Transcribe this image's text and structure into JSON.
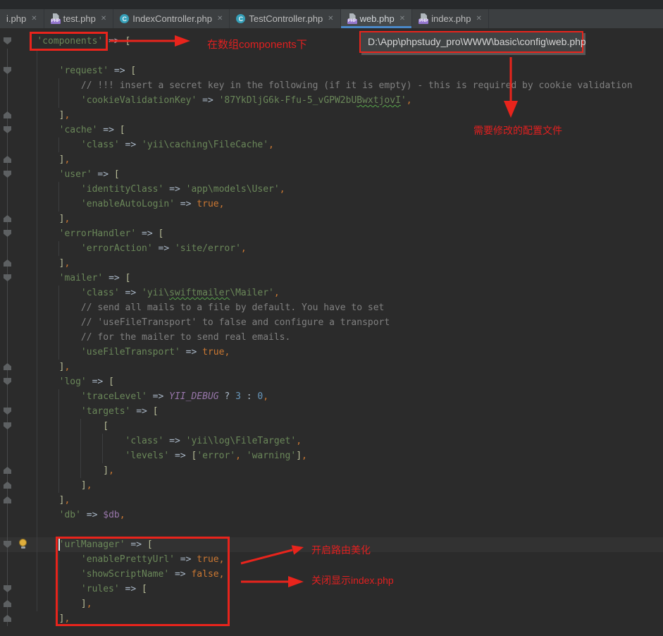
{
  "tabs": [
    {
      "label": "i.php",
      "icon": null,
      "active": false
    },
    {
      "label": "test.php",
      "icon": "php",
      "active": false
    },
    {
      "label": "IndexController.php",
      "icon": "class",
      "active": false
    },
    {
      "label": "TestController.php",
      "icon": "class",
      "active": false
    },
    {
      "label": "web.php",
      "icon": "php",
      "active": true
    },
    {
      "label": "index.php",
      "icon": "php",
      "active": false
    }
  ],
  "icons": {
    "close": "✕",
    "php_badge": "PHP",
    "class_badge": "C",
    "lightbulb": "intention-bulb"
  },
  "editor": {
    "current_line": 34,
    "bulb_line": 34,
    "caret_line": 34,
    "fold_starts": [
      0,
      2,
      6,
      9,
      13,
      16,
      23,
      25,
      26,
      34,
      37
    ],
    "fold_ends": [
      5,
      8,
      12,
      15,
      22,
      29,
      30,
      31,
      38,
      39
    ],
    "code_lines": [
      [
        [
          "t",
          "    "
        ],
        [
          "s",
          "'components'"
        ],
        [
          "o",
          " => "
        ],
        [
          "b",
          "["
        ]
      ],
      [],
      [
        [
          "t",
          "        "
        ],
        [
          "s",
          "'request'"
        ],
        [
          "o",
          " => "
        ],
        [
          "b",
          "["
        ]
      ],
      [
        [
          "t",
          "            "
        ],
        [
          "m",
          "// !!! insert a secret key in the following (if it is empty) - this is required by cookie validation"
        ]
      ],
      [
        [
          "t",
          "            "
        ],
        [
          "s",
          "'cookieValidationKey'"
        ],
        [
          "o",
          " => "
        ],
        [
          "s",
          "'87YkDljG6k-Ffu-5_vGPW2bU"
        ],
        [
          "w",
          "BwxtjovI"
        ],
        [
          "s",
          "'"
        ],
        [
          "c",
          ","
        ]
      ],
      [
        [
          "t",
          "        "
        ],
        [
          "b",
          "]"
        ],
        [
          "c",
          ","
        ]
      ],
      [
        [
          "t",
          "        "
        ],
        [
          "s",
          "'cache'"
        ],
        [
          "o",
          " => "
        ],
        [
          "b",
          "["
        ]
      ],
      [
        [
          "t",
          "            "
        ],
        [
          "s",
          "'class'"
        ],
        [
          "o",
          " => "
        ],
        [
          "s",
          "'yii\\caching\\FileCache'"
        ],
        [
          "c",
          ","
        ]
      ],
      [
        [
          "t",
          "        "
        ],
        [
          "b",
          "]"
        ],
        [
          "c",
          ","
        ]
      ],
      [
        [
          "t",
          "        "
        ],
        [
          "s",
          "'user'"
        ],
        [
          "o",
          " => "
        ],
        [
          "b",
          "["
        ]
      ],
      [
        [
          "t",
          "            "
        ],
        [
          "s",
          "'identityClass'"
        ],
        [
          "o",
          " => "
        ],
        [
          "s",
          "'app\\models\\User'"
        ],
        [
          "c",
          ","
        ]
      ],
      [
        [
          "t",
          "            "
        ],
        [
          "s",
          "'enableAutoLogin'"
        ],
        [
          "o",
          " => "
        ],
        [
          "k",
          "true"
        ],
        [
          "c",
          ","
        ]
      ],
      [
        [
          "t",
          "        "
        ],
        [
          "b",
          "]"
        ],
        [
          "c",
          ","
        ]
      ],
      [
        [
          "t",
          "        "
        ],
        [
          "s",
          "'errorHandler'"
        ],
        [
          "o",
          " => "
        ],
        [
          "b",
          "["
        ]
      ],
      [
        [
          "t",
          "            "
        ],
        [
          "s",
          "'errorAction'"
        ],
        [
          "o",
          " => "
        ],
        [
          "s",
          "'site/error'"
        ],
        [
          "c",
          ","
        ]
      ],
      [
        [
          "t",
          "        "
        ],
        [
          "b",
          "]"
        ],
        [
          "c",
          ","
        ]
      ],
      [
        [
          "t",
          "        "
        ],
        [
          "s",
          "'mailer'"
        ],
        [
          "o",
          " => "
        ],
        [
          "b",
          "["
        ]
      ],
      [
        [
          "t",
          "            "
        ],
        [
          "s",
          "'class'"
        ],
        [
          "o",
          " => "
        ],
        [
          "s",
          "'yii\\"
        ],
        [
          "w",
          "swiftmailer"
        ],
        [
          "s",
          "\\Mailer'"
        ],
        [
          "c",
          ","
        ]
      ],
      [
        [
          "t",
          "            "
        ],
        [
          "m",
          "// send all mails to a file by default. You have to set"
        ]
      ],
      [
        [
          "t",
          "            "
        ],
        [
          "m",
          "// 'useFileTransport' to false and configure a transport"
        ]
      ],
      [
        [
          "t",
          "            "
        ],
        [
          "m",
          "// for the mailer to send real emails."
        ]
      ],
      [
        [
          "t",
          "            "
        ],
        [
          "s",
          "'useFileTransport'"
        ],
        [
          "o",
          " => "
        ],
        [
          "k",
          "true"
        ],
        [
          "c",
          ","
        ]
      ],
      [
        [
          "t",
          "        "
        ],
        [
          "b",
          "]"
        ],
        [
          "c",
          ","
        ]
      ],
      [
        [
          "t",
          "        "
        ],
        [
          "s",
          "'log'"
        ],
        [
          "o",
          " => "
        ],
        [
          "b",
          "["
        ]
      ],
      [
        [
          "t",
          "            "
        ],
        [
          "s",
          "'traceLevel'"
        ],
        [
          "o",
          " => "
        ],
        [
          "d",
          "YII_DEBUG"
        ],
        [
          "o",
          " ? "
        ],
        [
          "n",
          "3"
        ],
        [
          "o",
          " : "
        ],
        [
          "n",
          "0"
        ],
        [
          "c",
          ","
        ]
      ],
      [
        [
          "t",
          "            "
        ],
        [
          "s",
          "'targets'"
        ],
        [
          "o",
          " => "
        ],
        [
          "b",
          "["
        ]
      ],
      [
        [
          "t",
          "                "
        ],
        [
          "b",
          "["
        ]
      ],
      [
        [
          "t",
          "                    "
        ],
        [
          "s",
          "'class'"
        ],
        [
          "o",
          " => "
        ],
        [
          "s",
          "'yii\\log\\FileTarget'"
        ],
        [
          "c",
          ","
        ]
      ],
      [
        [
          "t",
          "                    "
        ],
        [
          "s",
          "'levels'"
        ],
        [
          "o",
          " => "
        ],
        [
          "b",
          "["
        ],
        [
          "s",
          "'error'"
        ],
        [
          "c",
          ", "
        ],
        [
          "s",
          "'warning'"
        ],
        [
          "b",
          "]"
        ],
        [
          "c",
          ","
        ]
      ],
      [
        [
          "t",
          "                "
        ],
        [
          "b",
          "]"
        ],
        [
          "c",
          ","
        ]
      ],
      [
        [
          "t",
          "            "
        ],
        [
          "b",
          "]"
        ],
        [
          "c",
          ","
        ]
      ],
      [
        [
          "t",
          "        "
        ],
        [
          "b",
          "]"
        ],
        [
          "c",
          ","
        ]
      ],
      [
        [
          "t",
          "        "
        ],
        [
          "s",
          "'db'"
        ],
        [
          "o",
          " => "
        ],
        [
          "v",
          "$db"
        ],
        [
          "c",
          ","
        ]
      ],
      [],
      [
        [
          "t",
          "        "
        ],
        [
          "s",
          "'urlManager'"
        ],
        [
          "o",
          " => "
        ],
        [
          "b",
          "["
        ]
      ],
      [
        [
          "t",
          "            "
        ],
        [
          "s",
          "'enablePrettyUrl'"
        ],
        [
          "o",
          " => "
        ],
        [
          "k",
          "true"
        ],
        [
          "c",
          ","
        ]
      ],
      [
        [
          "t",
          "            "
        ],
        [
          "s",
          "'showScriptName'"
        ],
        [
          "o",
          " => "
        ],
        [
          "k",
          "false"
        ],
        [
          "c",
          ","
        ]
      ],
      [
        [
          "t",
          "            "
        ],
        [
          "s",
          "'rules'"
        ],
        [
          "o",
          " => "
        ],
        [
          "b",
          "["
        ]
      ],
      [
        [
          "t",
          "            "
        ],
        [
          "b",
          "]"
        ],
        [
          "c",
          ","
        ]
      ],
      [
        [
          "t",
          "        "
        ],
        [
          "b",
          "]"
        ],
        [
          "c",
          ","
        ]
      ]
    ]
  },
  "annotations": {
    "components_note": "在数组components下",
    "config_path": "D:\\App\\phpstudy_pro\\WWW\\basic\\config\\web.php",
    "config_note": "需要修改的配置文件",
    "pretty_url_note": "开启路由美化",
    "script_name_note": "关闭显示index.php"
  },
  "colors": {
    "annotation_red": "#e8241c",
    "active_tab_underline": "#4a88c7",
    "editor_background": "#2b2b2b",
    "string_green": "#6a8759",
    "keyword_orange": "#cc7832",
    "number_blue": "#6897bb",
    "constant_purple": "#9876aa",
    "comment_gray": "#808080"
  }
}
